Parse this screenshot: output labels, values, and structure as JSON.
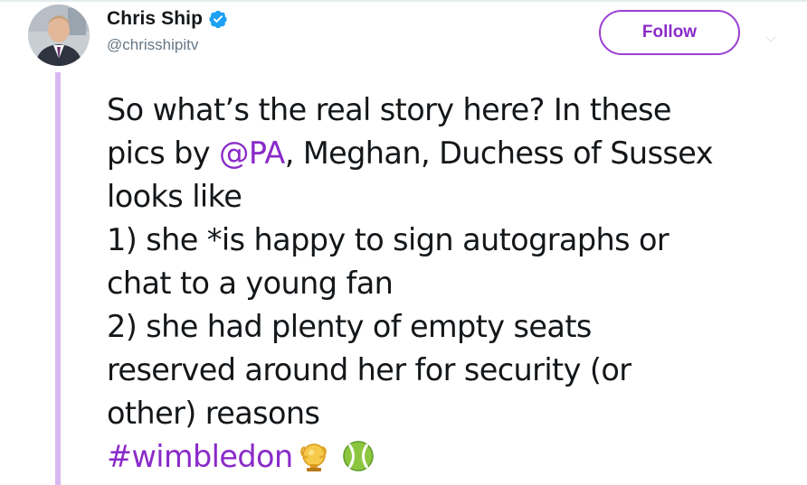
{
  "author": {
    "display_name": "Chris Ship",
    "handle": "@chrisshipitv",
    "verified_icon": "verified-badge-icon",
    "avatar": "avatar"
  },
  "follow_button": {
    "label": "Follow"
  },
  "tweet": {
    "line1": "So what’s the real story here? In these",
    "line2_pre": "pics by ",
    "mention": "@PA",
    "line2_post": ", Meghan, Duchess of Sussex",
    "line3": "looks like",
    "line4": "1) she *is happy to sign autographs or",
    "line5": "chat to a young fan",
    "line6": "2) she had plenty of empty seats",
    "line7": "reserved around her for security (or",
    "line8": "other) reasons",
    "hashtag": "#wimbledon",
    "emojis": [
      "trophy-icon",
      "tennis-ball-icon"
    ]
  },
  "colors": {
    "accent": "#8a2bc9",
    "thread_line": "#d9b8f1",
    "text": "#14171a",
    "secondary_text": "#657786",
    "verified": "#1da1f2"
  }
}
